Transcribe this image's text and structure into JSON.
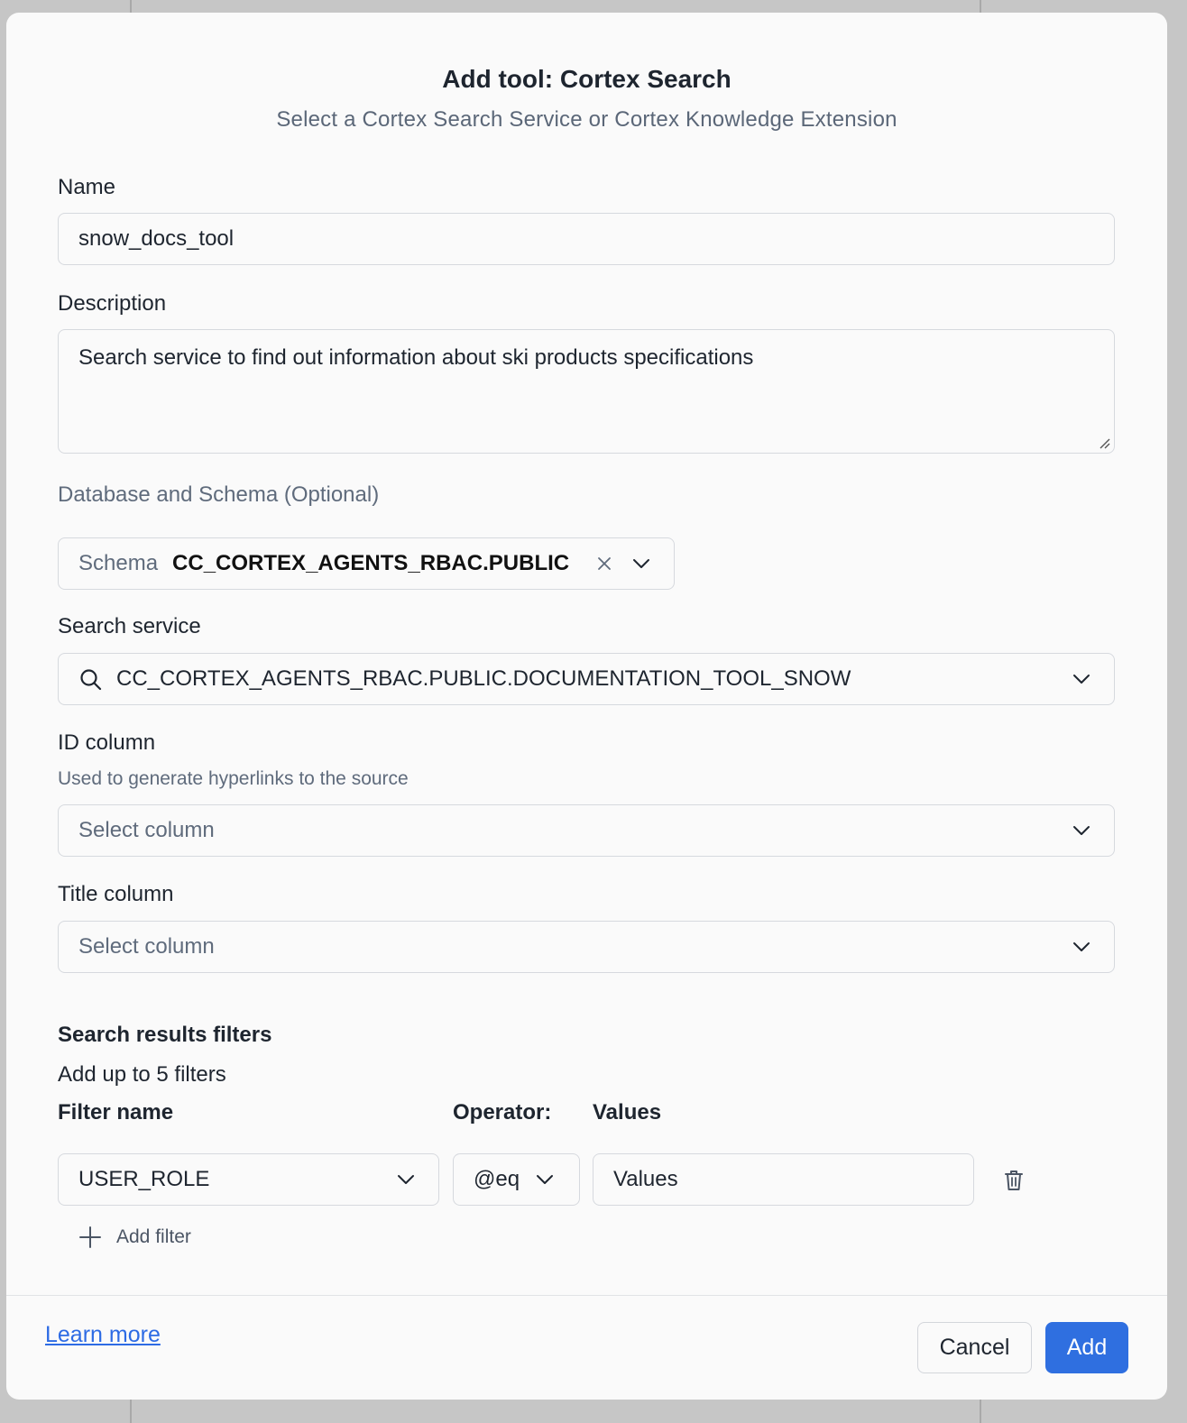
{
  "dialog": {
    "title": "Add tool: Cortex Search",
    "subtitle": "Select a Cortex Search Service or Cortex Knowledge Extension"
  },
  "name": {
    "label": "Name",
    "value": "snow_docs_tool"
  },
  "description": {
    "label": "Description",
    "value": "Search service to find out information about ski products specifications"
  },
  "database_schema": {
    "label": "Database and Schema (Optional)",
    "prefix": "Schema",
    "selected": "CC_CORTEX_AGENTS_RBAC.PUBLIC"
  },
  "search_service": {
    "label": "Search service",
    "value": "CC_CORTEX_AGENTS_RBAC.PUBLIC.DOCUMENTATION_TOOL_SNOW"
  },
  "id_column": {
    "label": "ID column",
    "hint": "Used to generate hyperlinks to the source",
    "placeholder": "Select column"
  },
  "title_column": {
    "label": "Title column",
    "placeholder": "Select column"
  },
  "filters": {
    "title": "Search results filters",
    "subtitle": "Add up to 5 filters",
    "headers": {
      "name": "Filter name",
      "operator": "Operator:",
      "values": "Values"
    },
    "rows": [
      {
        "name": "USER_ROLE",
        "operator": "@eq",
        "values_placeholder": "Values"
      }
    ],
    "add_label": "Add filter"
  },
  "footer": {
    "learn_more": "Learn more",
    "cancel": "Cancel",
    "add": "Add"
  },
  "colors": {
    "primary": "#2f6fe0",
    "link": "#2d6be4",
    "muted_text": "#5f6b7c"
  },
  "icons": [
    "close-icon",
    "chevron-down-icon",
    "search-icon",
    "trash-icon",
    "plus-icon",
    "resize-handle-icon"
  ]
}
